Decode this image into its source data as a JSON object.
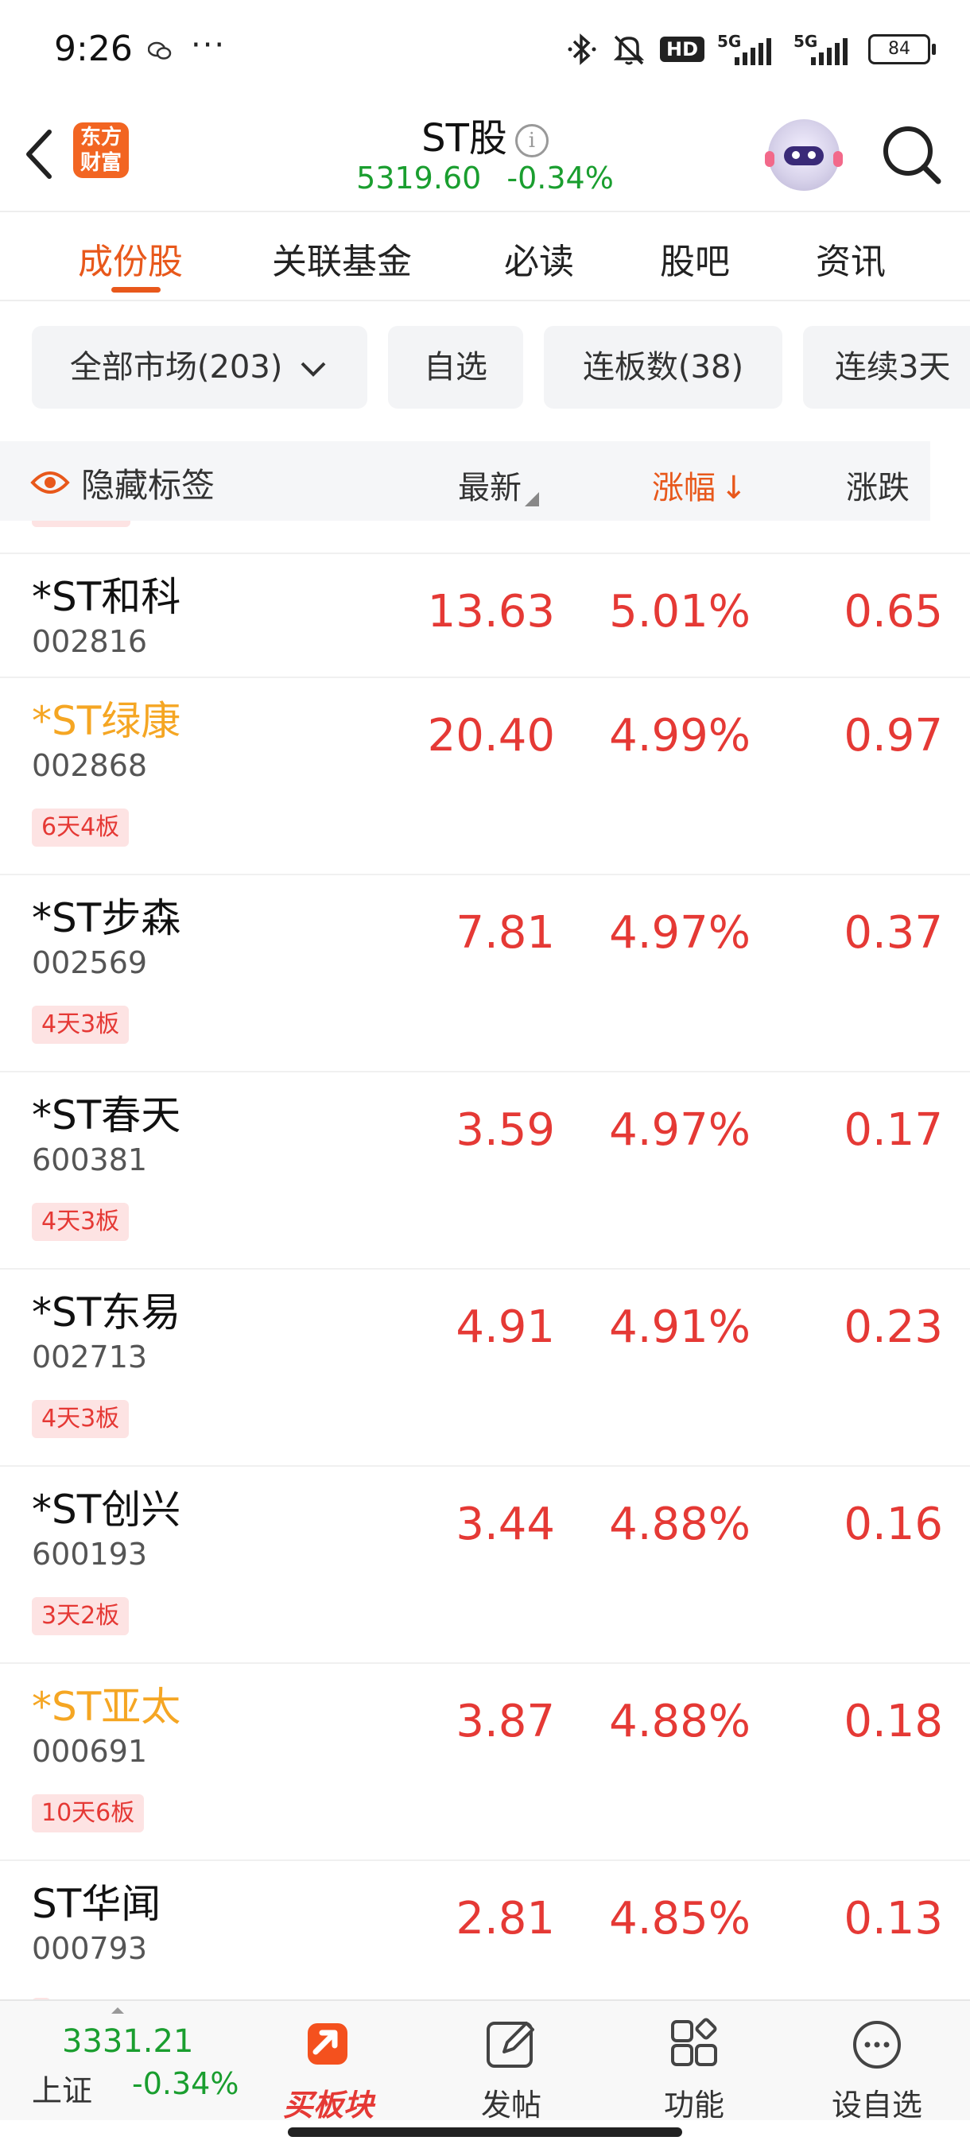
{
  "status_bar": {
    "time": "9:26",
    "more": "···",
    "hd": "HD",
    "net1": "5G",
    "net2": "5G",
    "battery": "84"
  },
  "header": {
    "logo_text": "东方财富",
    "title": "ST股",
    "info": "i",
    "index_value": "5319.60",
    "index_change": "-0.34%"
  },
  "tabs": [
    "成份股",
    "关联基金",
    "必读",
    "股吧",
    "资讯"
  ],
  "filters": [
    "全部市场(203)",
    "自选",
    "连板数(38)",
    "连续3天"
  ],
  "columns": {
    "hide_tags": "隐藏标签",
    "latest": "最新",
    "change_pct": "涨幅",
    "change_arrow": "↓",
    "change": "涨跌"
  },
  "stocks": [
    {
      "name": "*ST和科",
      "code": "002816",
      "latest": "13.63",
      "pct": "5.01%",
      "diff": "0.65",
      "tag": ""
    },
    {
      "name": "*ST绿康",
      "code": "002868",
      "latest": "20.40",
      "pct": "4.99%",
      "diff": "0.97",
      "tag": "6天4板"
    },
    {
      "name": "*ST步森",
      "code": "002569",
      "latest": "7.81",
      "pct": "4.97%",
      "diff": "0.37",
      "tag": "4天3板"
    },
    {
      "name": "*ST春天",
      "code": "600381",
      "latest": "3.59",
      "pct": "4.97%",
      "diff": "0.17",
      "tag": "4天3板"
    },
    {
      "name": "*ST东易",
      "code": "002713",
      "latest": "4.91",
      "pct": "4.91%",
      "diff": "0.23",
      "tag": "4天3板"
    },
    {
      "name": "*ST创兴",
      "code": "600193",
      "latest": "3.44",
      "pct": "4.88%",
      "diff": "0.16",
      "tag": "3天2板"
    },
    {
      "name": "*ST亚太",
      "code": "000691",
      "latest": "3.87",
      "pct": "4.88%",
      "diff": "0.18",
      "tag": "10天6板"
    },
    {
      "name": "ST华闻",
      "code": "000793",
      "latest": "2.81",
      "pct": "4.85%",
      "diff": "0.13",
      "tag": ""
    }
  ],
  "bottom_bar": {
    "index_value": "3331.21",
    "index_name": "上证",
    "index_pct": "-0.34%",
    "nav": [
      "买板块",
      "发帖",
      "功能",
      "设自选"
    ]
  },
  "colors": {
    "accent": "#e8581b",
    "up": "#e53935",
    "down": "#1a9e2f",
    "highlight_name": "#f5a623"
  }
}
